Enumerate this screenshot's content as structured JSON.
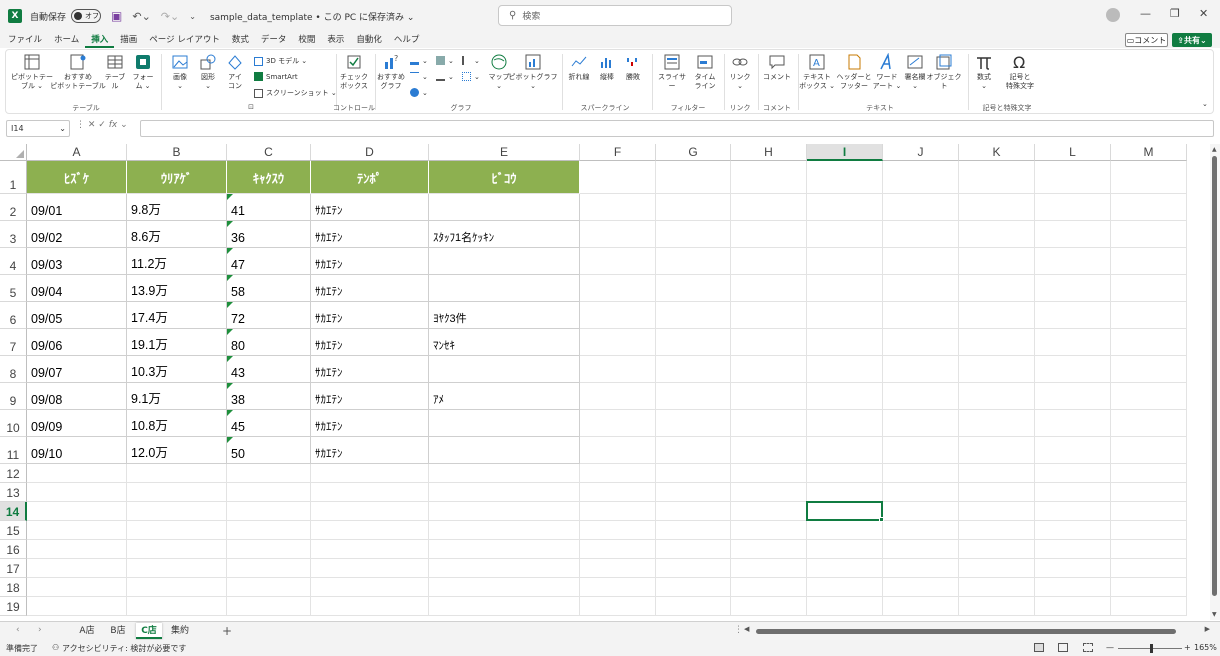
{
  "titlebar": {
    "autosave_label": "自動保存",
    "autosave_state": "オフ",
    "doc_title": "sample_data_template • この PC に保存済み ⌄",
    "search_placeholder": "検索"
  },
  "menu_tabs": [
    "ファイル",
    "ホーム",
    "挿入",
    "描画",
    "ページ レイアウト",
    "数式",
    "データ",
    "校閲",
    "表示",
    "自動化",
    "ヘルプ"
  ],
  "active_menu_tab": "挿入",
  "header_buttons": {
    "comment": "コメント",
    "share": "共有"
  },
  "ribbon": {
    "pivot_table": "ピボットテー\nブル ⌄",
    "recommended_pivot": "おすすめ\nピボットテーブル",
    "table": "テーブル",
    "forms": "フォー\nム ⌄",
    "group_table": "テーブル",
    "images": "画像\n⌄",
    "shapes": "図形\n⌄",
    "icons": "アイ\nコン",
    "model_3d": "3D モデル",
    "smartart": "SmartArt",
    "screenshot": "スクリーンショット ⌄",
    "checkbox": "チェック\nボックス",
    "group_control": "コントロール",
    "recommended_chart": "おすすめ\nグラフ",
    "map": "マップ\n⌄",
    "pivot_chart": "ピボットグラフ\n⌄",
    "group_chart": "グラフ",
    "line_spark": "折れ線",
    "column_spark": "縦棒",
    "winloss_spark": "勝敗",
    "group_sparkline": "スパークライン",
    "slicer": "スライサー",
    "timeline": "タイム\nライン",
    "group_filter": "フィルター",
    "link": "リンク\n⌄",
    "group_link": "リンク",
    "comment": "コメント",
    "group_comment": "コメント",
    "textbox": "テキスト\nボックス ⌄",
    "header_footer": "ヘッダーと\nフッター",
    "wordart": "ワード\nアート ⌄",
    "signature": "署名欄\n⌄",
    "object": "オブジェクト",
    "group_text": "テキスト",
    "equation": "数式\n⌄",
    "symbol": "記号と\n特殊文字",
    "group_symbols": "記号と特殊文字"
  },
  "formula_bar": {
    "name_box": "I14",
    "fx": "fx",
    "value": ""
  },
  "columns": [
    "A",
    "B",
    "C",
    "D",
    "E",
    "F",
    "G",
    "H",
    "I",
    "J",
    "K",
    "L",
    "M"
  ],
  "active_column": "I",
  "rows": [
    "1",
    "2",
    "3",
    "4",
    "5",
    "6",
    "7",
    "8",
    "9",
    "10",
    "11",
    "12",
    "13",
    "14",
    "15",
    "16",
    "17",
    "18",
    "19"
  ],
  "active_row": "14",
  "table": {
    "headers": [
      "ﾋｽﾞｹ",
      "ｳﾘｱｹﾞ",
      "ｷｬｸｽｳ",
      "ﾃﾝﾎﾟ",
      "ﾋﾞｺｳ"
    ],
    "rows": [
      [
        "09/01",
        "9.8万",
        "41",
        "ｻｶｴﾃﾝ",
        ""
      ],
      [
        "09/02",
        "8.6万",
        "36",
        "ｻｶｴﾃﾝ",
        "ｽﾀｯﾌ1名ｹｯｷﾝ"
      ],
      [
        "09/03",
        "11.2万",
        "47",
        "ｻｶｴﾃﾝ",
        ""
      ],
      [
        "09/04",
        "13.9万",
        "58",
        "ｻｶｴﾃﾝ",
        ""
      ],
      [
        "09/05",
        "17.4万",
        "72",
        "ｻｶｴﾃﾝ",
        "ﾖﾔｸ3件"
      ],
      [
        "09/06",
        "19.1万",
        "80",
        "ｻｶｴﾃﾝ",
        "ﾏﾝｾｷ"
      ],
      [
        "09/07",
        "10.3万",
        "43",
        "ｻｶｴﾃﾝ",
        ""
      ],
      [
        "09/08",
        "9.1万",
        "38",
        "ｻｶｴﾃﾝ",
        "ｱﾒ"
      ],
      [
        "09/09",
        "10.8万",
        "45",
        "ｻｶｴﾃﾝ",
        ""
      ],
      [
        "09/10",
        "12.0万",
        "50",
        "ｻｶｴﾃﾝ",
        ""
      ]
    ]
  },
  "sheets": [
    "A店",
    "B店",
    "C店",
    "集約"
  ],
  "active_sheet": "C店",
  "status": {
    "ready": "準備完了",
    "accessibility": "アクセシビリティ: 検討が必要です",
    "zoom": "165%"
  },
  "colors": {
    "accent": "#107c41",
    "table_header": "#8db050"
  }
}
